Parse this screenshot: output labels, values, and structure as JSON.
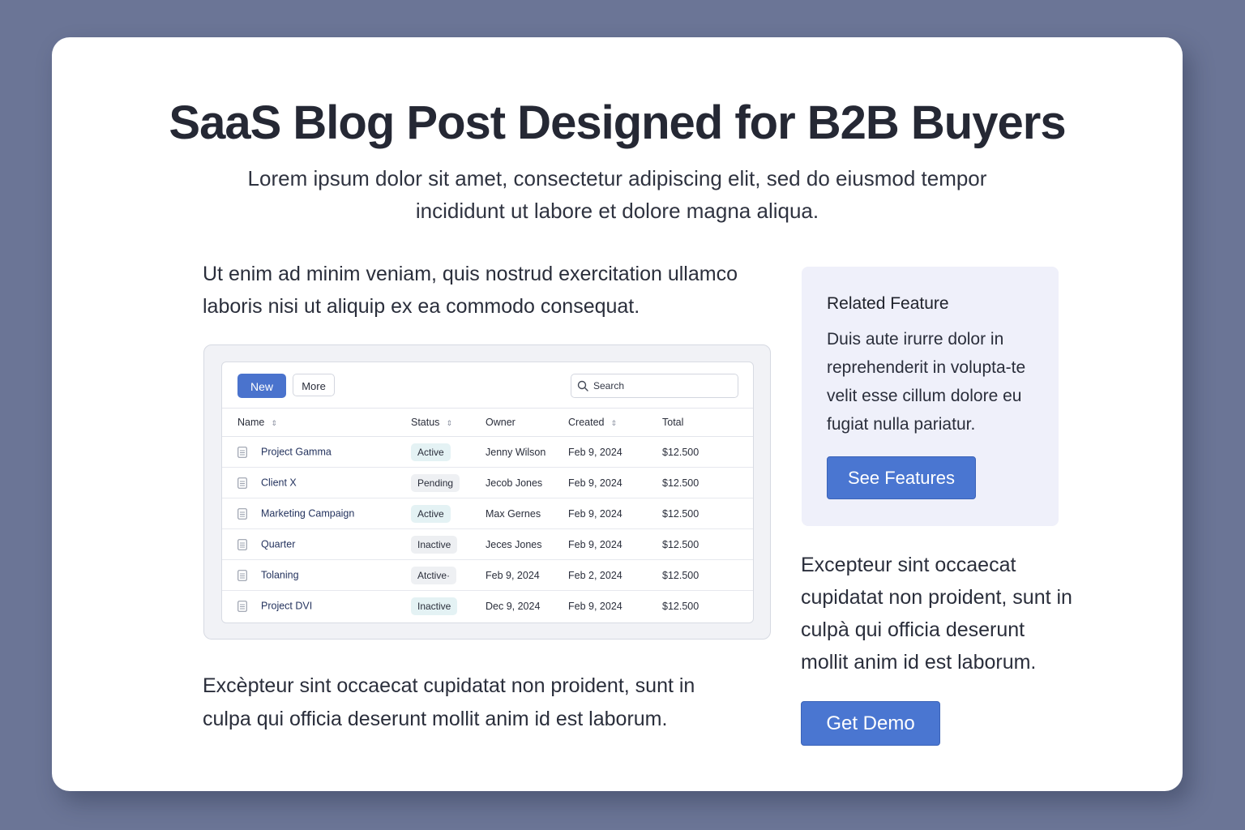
{
  "page": {
    "title": "SaaS Blog Post Designed for B2B Buyers",
    "subtitle": "Lorem ipsum dolor sit amet, consectetur adipiscing elit, sed do eiusmod tempor incididunt ut labore et dolore magna aliqua.",
    "intro": "Ut enim ad minim veniam, quis nostrud exercitation ullamco laboris nisi ut aliquip ex ea commodo consequat.",
    "outro": "Excèpteur sint occaecat cupidatat non proident, sunt in culpa qui officia deserunt mollit anim id est laborum."
  },
  "app": {
    "toolbar": {
      "new_label": "New",
      "more_label": "More",
      "search_placeholder": "Search"
    },
    "columns": [
      "Name",
      "Status",
      "Owner",
      "Created",
      "Total"
    ],
    "rows": [
      {
        "name": "Project Gamma",
        "status": "Active",
        "owner": "Jenny Wilson",
        "created": "Feb 9, 2024",
        "total": "$12.500"
      },
      {
        "name": "Client X",
        "status": "Pending",
        "owner": "Jecob Jones",
        "created": "Feb 9, 2024",
        "total": "$12.500"
      },
      {
        "name": "Marketing Campaign",
        "status": "Active",
        "owner": "Max Gernes",
        "created": "Feb 9, 2024",
        "total": "$12.500"
      },
      {
        "name": "Quarter",
        "status": "Inactive",
        "owner": "Jeces Jones",
        "created": "Feb 9, 2024",
        "total": "$12.500"
      },
      {
        "name": "Tolaning",
        "status": "Atctive·",
        "owner": "Feb 9, 2024",
        "created": "Feb 2, 2024",
        "total": "$12.500"
      },
      {
        "name": "Project DVI",
        "status": "Inactive",
        "owner": "Dec 9, 2024",
        "created": "Feb 9, 2024",
        "total": "$12.500"
      }
    ]
  },
  "related": {
    "title": "Related Feature",
    "body": "Duis aute irurre dolor in reprehenderit in volupta-te velit esse cillum dolore eu fugiat nulla pariatur.",
    "button_label": "See Features"
  },
  "side": {
    "paragraph": "Excepteur sint occaecat cupidatat non proident, sunt in culpà qui officia deserunt mollit anim id est laborum.",
    "button_label": "Get Demo"
  },
  "colors": {
    "background": "#6b7596",
    "accent": "#4a76d1",
    "related_bg": "#eff0fa"
  }
}
